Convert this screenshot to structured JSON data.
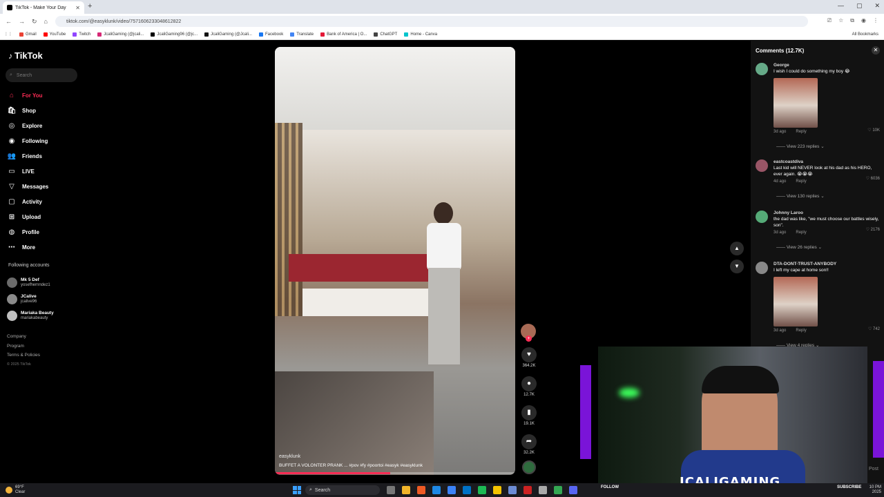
{
  "browser": {
    "tab_title": "TikTok - Make Your Day",
    "url": "tiktok.com/@easyklunk/video/7571606233048612822",
    "all_bookmarks": "All Bookmarks",
    "bookmarks": [
      {
        "label": "Gmail",
        "color": "#ea4335"
      },
      {
        "label": "YouTube",
        "color": "#ff0000"
      },
      {
        "label": "Twitch",
        "color": "#9146ff"
      },
      {
        "label": "JcaliGaming (@jcali...",
        "color": "#d62976"
      },
      {
        "label": "JcaliGaming96 (@jc...",
        "color": "#000000"
      },
      {
        "label": "JcaliGaming (@Jcali...",
        "color": "#111111"
      },
      {
        "label": "Facebook",
        "color": "#1877f2"
      },
      {
        "label": "Translate",
        "color": "#4285f4"
      },
      {
        "label": "Bank of America | O...",
        "color": "#e31837"
      },
      {
        "label": "ChatGPT",
        "color": "#444444"
      },
      {
        "label": "Home - Canva",
        "color": "#00c4cc"
      }
    ]
  },
  "sidebar": {
    "logo": "TikTok",
    "search_placeholder": "Search",
    "nav": [
      {
        "label": "For You",
        "icon": "home-icon",
        "glyph": "⌂",
        "active": true
      },
      {
        "label": "Shop",
        "icon": "shop-icon",
        "glyph": "🛍",
        "active": false
      },
      {
        "label": "Explore",
        "icon": "compass-icon",
        "glyph": "◎",
        "active": false
      },
      {
        "label": "Following",
        "icon": "following-icon",
        "glyph": "◉",
        "active": false
      },
      {
        "label": "Friends",
        "icon": "friends-icon",
        "glyph": "👥",
        "active": false
      },
      {
        "label": "LIVE",
        "icon": "live-icon",
        "glyph": "▭",
        "active": false
      },
      {
        "label": "Messages",
        "icon": "messages-icon",
        "glyph": "▽",
        "active": false
      },
      {
        "label": "Activity",
        "icon": "activity-icon",
        "glyph": "▢",
        "active": false
      },
      {
        "label": "Upload",
        "icon": "upload-icon",
        "glyph": "⊞",
        "active": false
      },
      {
        "label": "Profile",
        "icon": "profile-icon",
        "glyph": "◍",
        "active": false
      },
      {
        "label": "More",
        "icon": "more-icon",
        "glyph": "⋯",
        "active": false
      }
    ],
    "following_title": "Following accounts",
    "following": [
      {
        "name": "Mk 5 Def",
        "handle": "yosefhernndez1"
      },
      {
        "name": "JCalive",
        "handle": "jcalive96"
      },
      {
        "name": "Mariaka Beauty",
        "handle": "mariakabeauty"
      }
    ],
    "footer": [
      "Company",
      "Program",
      "Terms & Policies"
    ],
    "copyright": "© 2025 TikTok"
  },
  "video": {
    "username": "easyklunk",
    "caption": "BUFFET A VOLONTER PRANK ... #pov #fy #poortoi #easyk #easyklunk",
    "progress": 0.48
  },
  "actions": {
    "likes": "364.2K",
    "comments": "12.7K",
    "saves": "19.1K",
    "shares": "32.2K"
  },
  "comments_panel": {
    "title": "Comments (12.7K)",
    "items": [
      {
        "user": "George",
        "text": "I wish I could do something my boy 😂",
        "has_image": true,
        "age": "3d ago",
        "reply": "Reply",
        "likes": "10K",
        "replies": "View 223 replies"
      },
      {
        "user": "eastcoastdiva",
        "text": "Last kid will NEVER look at his dad as his HERO, ever again. 😭😭😭",
        "has_image": false,
        "age": "4d ago",
        "reply": "Reply",
        "likes": "6036",
        "replies": "View 130 replies"
      },
      {
        "user": "Johnny Laroo",
        "text": "the dad was like, \"we must choose our battles wisely, son\".",
        "has_image": false,
        "age": "3d ago",
        "reply": "Reply",
        "likes": "2176",
        "replies": "View 26 replies"
      },
      {
        "user": "DTA-DONT-TRUST-ANYBODY",
        "text": "I left my cape at home son!!",
        "has_image": true,
        "age": "3d ago",
        "reply": "Reply",
        "likes": "742",
        "replies": "View 4 replies"
      }
    ]
  },
  "overlay": {
    "brand": "JCALIGAMING",
    "follow": "FOLLOW",
    "subscribe": "SUBSCRIBE",
    "post": "Post"
  },
  "taskbar": {
    "temp": "69°F",
    "weather": "Clear",
    "search": "Search",
    "time": "10 PM",
    "date": "2025"
  }
}
